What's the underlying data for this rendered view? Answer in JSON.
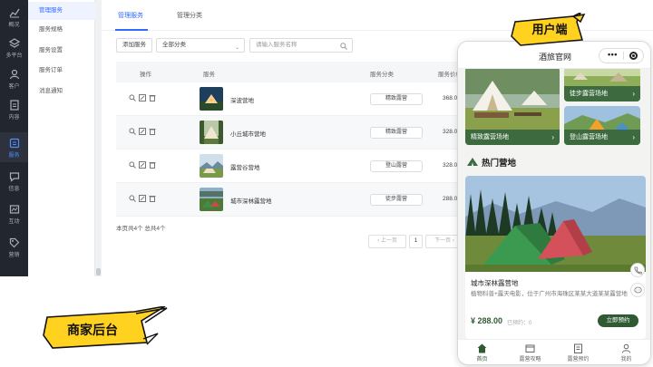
{
  "admin": {
    "left_nav": [
      {
        "label": "概况",
        "icon": "chart-icon"
      },
      {
        "label": "多平台",
        "icon": "layers-icon"
      },
      {
        "label": "客户",
        "icon": "user-icon"
      },
      {
        "label": "内容",
        "icon": "document-icon"
      },
      {
        "label": "服务",
        "icon": "service-icon"
      },
      {
        "label": "信息",
        "icon": "message-icon"
      },
      {
        "label": "互动",
        "icon": "interaction-icon"
      },
      {
        "label": "营销",
        "icon": "tag-icon"
      }
    ],
    "sub_nav": [
      "管理服务",
      "服务规格",
      "服务设置",
      "服务订单",
      "消息通知"
    ],
    "tabs": [
      "管理服务",
      "管理分类"
    ],
    "toolbar": {
      "add_label": "添加服务",
      "category_select": "全部分类",
      "search_placeholder": "请输入服务名称"
    },
    "table": {
      "headers": [
        "操作",
        "服务",
        "服务分类",
        "服务价格"
      ],
      "rows": [
        {
          "name": "深波营地",
          "category": "精致露营",
          "price": "368.0"
        },
        {
          "name": "小丘城市营地",
          "category": "精致露营",
          "price": "328.0"
        },
        {
          "name": "露营谷营地",
          "category": "登山露营",
          "price": "328.0"
        },
        {
          "name": "城市深林露营地",
          "category": "徒步露营",
          "price": "288.0"
        }
      ]
    },
    "footer": {
      "count_text": "本页共4个  总共4个"
    },
    "pager": {
      "prev": "上一页",
      "page": "1",
      "next": "下一页"
    }
  },
  "phone": {
    "title": "酒旅官网",
    "cards": [
      {
        "label": "徒步露营场地"
      },
      {
        "label": "精致露营场地"
      },
      {
        "label": "登山露营场地"
      }
    ],
    "hot_section_title": "热门营地",
    "hot": {
      "name": "城市深林露营地",
      "desc": "植物科普+露天电影，位于广州市海珠区某某大道某某露营地",
      "price": "¥ 288.00",
      "booked": "已预约：0",
      "book_label": "立即预约"
    },
    "tabbar": [
      {
        "label": "首页",
        "icon": "home-icon"
      },
      {
        "label": "露营攻略",
        "icon": "guide-icon"
      },
      {
        "label": "露营预约",
        "icon": "calendar-icon"
      },
      {
        "label": "我的",
        "icon": "profile-icon"
      }
    ]
  },
  "stickers": {
    "user_side": "用户端",
    "merchant_side": "商家后台"
  },
  "colors": {
    "accent": "#2f6bff",
    "nav_bg": "#22262e",
    "sticker_yellow": "#ffd21f",
    "camp_green": "#3d6b3f"
  }
}
